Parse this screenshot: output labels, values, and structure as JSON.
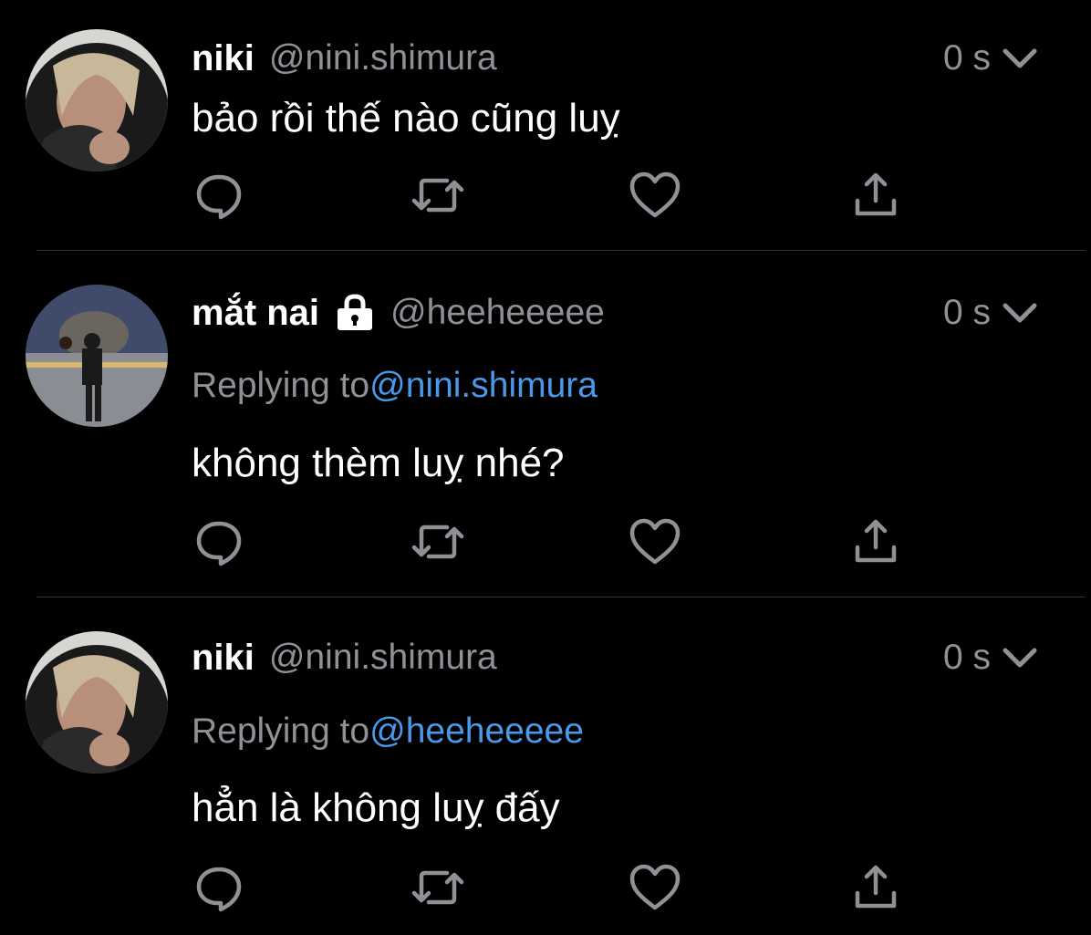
{
  "colors": {
    "background": "#000000",
    "primary_text": "#ffffff",
    "secondary_text": "#8e9297",
    "link": "#4a99e9",
    "divider": "#2f3336"
  },
  "tweets": [
    {
      "name": "niki",
      "handle": "@nini.shimura",
      "time": "0 s",
      "locked": false,
      "replying_label": "",
      "replying_to": "",
      "text": "bảo rồi thế nào cũng luỵ"
    },
    {
      "name": "mắt nai",
      "handle": "@heeheeeee",
      "time": "0 s",
      "locked": true,
      "replying_label": "Replying to",
      "replying_to": "@nini.shimura",
      "text": "không thèm luỵ nhé?"
    },
    {
      "name": "niki",
      "handle": "@nini.shimura",
      "time": "0 s",
      "locked": false,
      "replying_label": "Replying to",
      "replying_to": "@heeheeeee",
      "text": "hẳn là không luỵ đấy"
    }
  ],
  "icons": {
    "reply": "reply-icon",
    "retweet": "retweet-icon",
    "like": "heart-icon",
    "share": "share-icon",
    "more": "chevron-down-icon",
    "lock": "lock-icon"
  }
}
